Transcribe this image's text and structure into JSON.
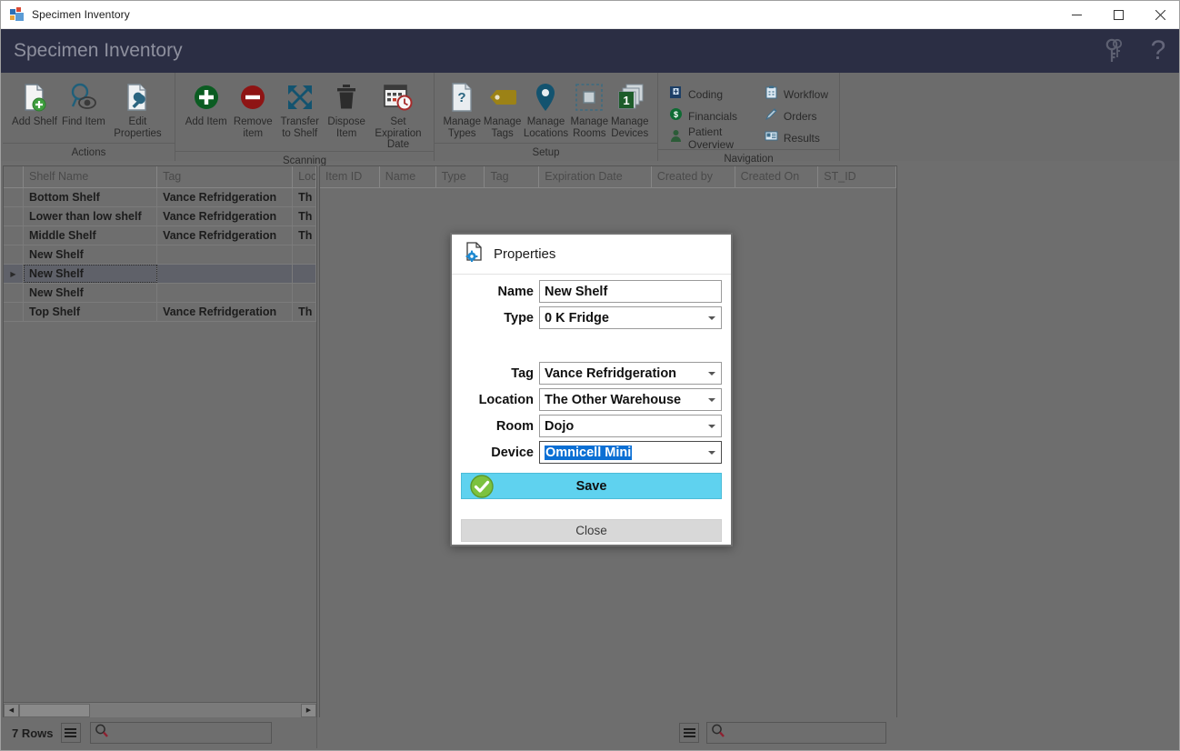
{
  "window": {
    "title": "Specimen Inventory",
    "icon": "app-squares-icon",
    "controls": {
      "minimize": "—",
      "maximize": "□",
      "close": "✕"
    }
  },
  "header": {
    "title": "Specimen Inventory",
    "icons": [
      {
        "name": "keys-icon",
        "glyph": "⚷"
      },
      {
        "name": "help-icon",
        "glyph": "?"
      }
    ]
  },
  "ribbon": {
    "groups": [
      {
        "label": "Actions",
        "type": "large",
        "buttons": [
          {
            "label": "Add Shelf",
            "icon": "document-add-icon"
          },
          {
            "label": "Find Item",
            "icon": "magnifier-eye-icon"
          },
          {
            "label": "Edit Properties",
            "icon": "document-wrench-icon"
          }
        ]
      },
      {
        "label": "Scanning",
        "type": "large",
        "buttons": [
          {
            "label": "Add Item",
            "icon": "plus-circle-icon"
          },
          {
            "label": "Remove item",
            "icon": "minus-circle-icon"
          },
          {
            "label": "Transfer to Shelf",
            "icon": "four-arrows-icon"
          },
          {
            "label": "Dispose Item",
            "icon": "trash-icon"
          },
          {
            "label": "Set Expiration Date",
            "icon": "calendar-clock-icon"
          }
        ]
      },
      {
        "label": "Setup",
        "type": "large",
        "buttons": [
          {
            "label": "Manage Types",
            "icon": "document-question-icon"
          },
          {
            "label": "Manage Tags",
            "icon": "tag-icon"
          },
          {
            "label": "Manage Locations",
            "icon": "map-pin-icon"
          },
          {
            "label": "Manage Rooms",
            "icon": "room-dashed-square-icon"
          },
          {
            "label": "Manage Devices",
            "icon": "device-stack-icon"
          }
        ]
      },
      {
        "label": "Navigation",
        "type": "small",
        "buttons": [
          {
            "label": "Coding",
            "icon": "book-icon"
          },
          {
            "label": "Workflow",
            "icon": "clipboard-icon"
          },
          {
            "label": "Financials",
            "icon": "dollar-circle-icon"
          },
          {
            "label": "Orders",
            "icon": "pencil-icon"
          },
          {
            "label": "Patient Overview",
            "icon": "patient-icon"
          },
          {
            "label": "Results",
            "icon": "results-card-icon"
          }
        ]
      }
    ]
  },
  "grid_left": {
    "columns": [
      "Shelf Name",
      "Tag",
      "Loc"
    ],
    "rows": [
      {
        "shelf_name": "Bottom Shelf",
        "tag": "Vance Refridgeration",
        "location": "Th",
        "selected": false
      },
      {
        "shelf_name": "Lower than low shelf",
        "tag": "Vance Refridgeration",
        "location": "Th",
        "selected": false
      },
      {
        "shelf_name": "Middle Shelf",
        "tag": "Vance Refridgeration",
        "location": "Th",
        "selected": false
      },
      {
        "shelf_name": "New Shelf",
        "tag": "",
        "location": "",
        "selected": false
      },
      {
        "shelf_name": "New Shelf",
        "tag": "",
        "location": "",
        "selected": true
      },
      {
        "shelf_name": "New Shelf",
        "tag": "",
        "location": "",
        "selected": false
      },
      {
        "shelf_name": "Top Shelf",
        "tag": "Vance Refridgeration",
        "location": "Th",
        "selected": false
      }
    ]
  },
  "grid_right": {
    "columns": [
      "Item ID",
      "Name",
      "Type",
      "Tag",
      "Expiration Date",
      "Created by",
      "Created On",
      "ST_ID"
    ],
    "rows": []
  },
  "statusbar": {
    "rows_label": "7 Rows",
    "menu_icon": "hamburger-menu-icon",
    "search_icon": "search-icon",
    "left_search_value": "",
    "right_search_value": ""
  },
  "dialog": {
    "icon": "document-gear-icon",
    "title": "Properties",
    "fields": [
      {
        "label": "Name",
        "value": "New Shelf",
        "type": "text",
        "selected": false
      },
      {
        "label": "Type",
        "value": "0 K Fridge",
        "type": "combo",
        "selected": false
      },
      {
        "label": "Tag",
        "value": "Vance Refridgeration",
        "type": "combo",
        "selected": false
      },
      {
        "label": "Location",
        "value": "The Other Warehouse",
        "type": "combo",
        "selected": false
      },
      {
        "label": "Room",
        "value": "Dojo",
        "type": "combo",
        "selected": false
      },
      {
        "label": "Device",
        "value": "Omnicell Mini",
        "type": "combo",
        "selected": true
      }
    ],
    "save_label": "Save",
    "save_icon": "green-check-icon",
    "close_label": "Close"
  },
  "colors": {
    "header_bg": "#2b2e44",
    "ribbon_bg": "#6c6c6c",
    "grid_bg": "#6e6e6e",
    "save_button": "#5fd2ef",
    "selection_blue": "#0b6fd4",
    "accent_teal": "#1f6a8c"
  }
}
